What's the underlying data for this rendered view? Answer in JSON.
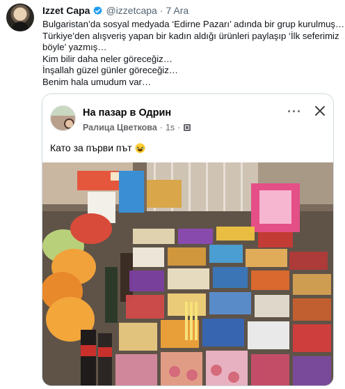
{
  "tweet": {
    "author_name": "Izzet Capa",
    "handle": "@izzetcapa",
    "separator": "·",
    "date": "7 Ara",
    "text_lines": [
      "Bulgaristan’da sosyal medyada ‘Edirne Pazarı’ adında bir grup kurulmuş…",
      "Türkiye’den alışveriş yapan bir kadın aldığı ürünleri paylaşıp ‘İlk seferimiz",
      "böyle’ yazmış…",
      "Kim bilir daha neler göreceğiz…",
      "İnşallah güzel günler göreceğiz…",
      "Benim hala umudum var…"
    ]
  },
  "embedded_post": {
    "group_name": "На пазар в Одрин",
    "author": "Ралица Цветкова",
    "separator": "·",
    "time": "1s",
    "text": "Като  за първи път",
    "icons": [
      "globe-icon",
      "more-options-icon",
      "close-icon",
      "laughing-emoji-icon"
    ]
  },
  "colors": {
    "verified_blue": "#1d9bf0",
    "secondary_text": "#536471",
    "card_border": "#cfd9de"
  }
}
